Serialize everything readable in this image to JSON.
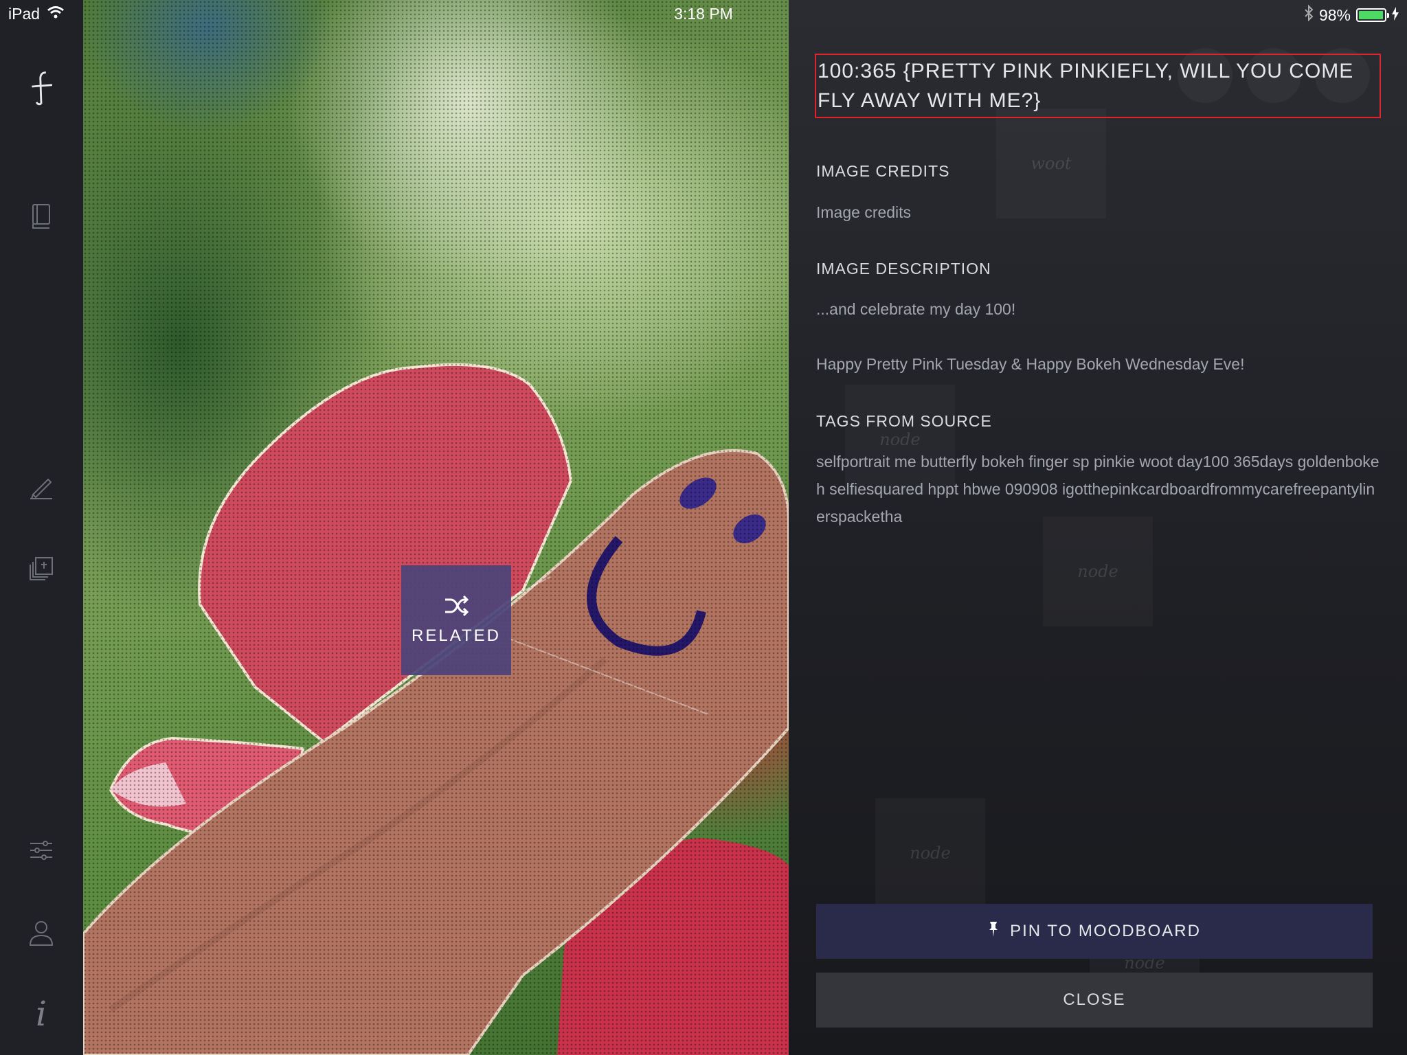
{
  "status_bar": {
    "device": "iPad",
    "time": "3:18 PM",
    "battery": "98%",
    "battery_level": 0.98,
    "icons": [
      "wifi-icon",
      "bluetooth-icon",
      "battery-icon",
      "charging-icon"
    ]
  },
  "sidebar": {
    "items": [
      {
        "name": "logo",
        "icon": "app-logo-icon"
      },
      {
        "name": "library",
        "icon": "book-icon"
      },
      {
        "name": "edit",
        "icon": "pen-icon"
      },
      {
        "name": "moodboards",
        "icon": "pinned-stack-icon"
      },
      {
        "name": "settings",
        "icon": "sliders-icon"
      },
      {
        "name": "profile",
        "icon": "user-icon"
      },
      {
        "name": "info",
        "icon": "info-icon",
        "glyph": "i"
      }
    ]
  },
  "photo": {
    "related_label": "RELATED",
    "related_icon": "shuffle-icon",
    "node_label": "node"
  },
  "panel": {
    "title": "100:365 {Pretty Pink Pinkiefly, will you come fly away with me?}",
    "credits_heading": "IMAGE CREDITS",
    "credits_text": "Image credits",
    "description_heading": "IMAGE DESCRIPTION",
    "description_line1": "...and celebrate my day 100!",
    "description_line2": "Happy Pretty Pink Tuesday & Happy Bokeh Wednesday Eve!",
    "tags_heading": "TAGS FROM SOURCE",
    "tags_text": "selfportrait me butterfly bokeh finger sp pinkie woot day100 365days goldenbokeh selfiesquared hppt hbwe 090908 igotthepinkcardboardfrommycarefreepantylinerspacketha",
    "background_nodes": [
      "woot",
      "node",
      "node",
      "node",
      "node"
    ],
    "pin_label": "PIN TO MOODBOARD",
    "pin_icon": "pushpin-icon",
    "close_label": "CLOSE"
  },
  "colors": {
    "sidebar_bg": "#202127",
    "panel_bg": "#26282d",
    "related_bg": "#4c447a",
    "pin_bg": "#2a2b4a",
    "close_bg": "#34363c",
    "highlight": "#e0232d"
  }
}
